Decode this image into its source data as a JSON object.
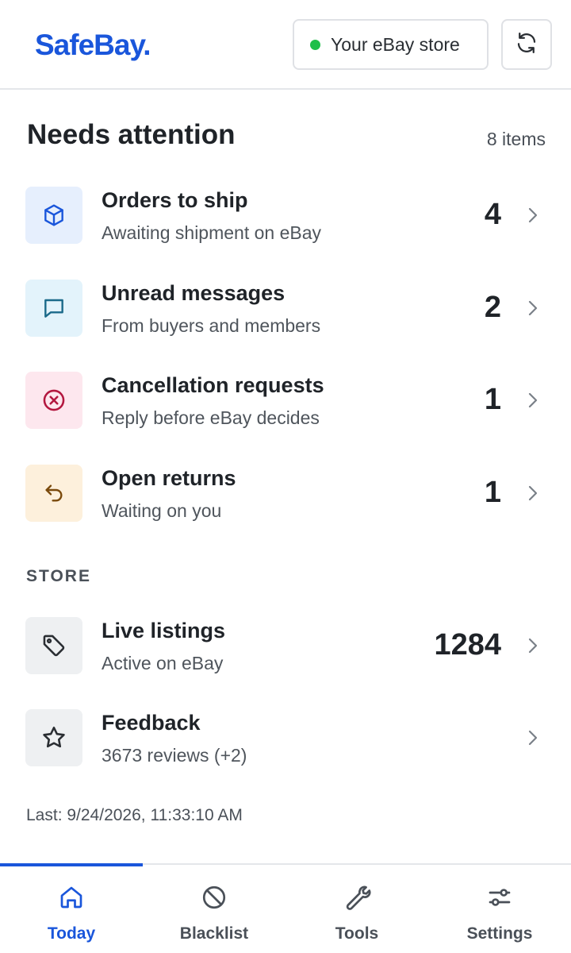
{
  "header": {
    "logo": "SafeBay.",
    "store_button": "Your eBay store",
    "refresh_icon": "refresh-icon"
  },
  "attention": {
    "title": "Needs attention",
    "count_text": "8 items",
    "items": [
      {
        "title": "Orders to ship",
        "subtitle": "Awaiting shipment on eBay",
        "count": "4",
        "icon": "package-icon",
        "icon_bg": "#e6effd",
        "icon_color": "#1a56db"
      },
      {
        "title": "Unread messages",
        "subtitle": "From buyers and members",
        "count": "2",
        "icon": "message-icon",
        "icon_bg": "#e3f3fb",
        "icon_color": "#1b6a8a"
      },
      {
        "title": "Cancellation requests",
        "subtitle": "Reply before eBay decides",
        "count": "1",
        "icon": "cancel-circle-icon",
        "icon_bg": "#fde7ee",
        "icon_color": "#b3173f"
      },
      {
        "title": "Open returns",
        "subtitle": "Waiting on you",
        "count": "1",
        "icon": "return-arrow-icon",
        "icon_bg": "#fdf0dc",
        "icon_color": "#7a4a0c"
      }
    ]
  },
  "store": {
    "label": "STORE",
    "items": [
      {
        "title": "Live listings",
        "subtitle": "Active on eBay",
        "count": "1284",
        "icon": "tag-icon",
        "icon_bg": "#eef0f2",
        "icon_color": "#2a2e33"
      },
      {
        "title": "Feedback",
        "subtitle": "3673 reviews (+2)",
        "count": "",
        "icon": "star-icon",
        "icon_bg": "#eef0f2",
        "icon_color": "#2a2e33"
      }
    ]
  },
  "last_updated": "Last: 9/24/2026, 11:33:10 AM",
  "nav": {
    "items": [
      {
        "label": "Today",
        "icon": "home-icon",
        "active": true
      },
      {
        "label": "Blacklist",
        "icon": "block-icon",
        "active": false
      },
      {
        "label": "Tools",
        "icon": "wrench-icon",
        "active": false
      },
      {
        "label": "Settings",
        "icon": "sliders-icon",
        "active": false
      }
    ]
  },
  "colors": {
    "accent": "#1a56db",
    "status_online": "#1fbf4a"
  }
}
